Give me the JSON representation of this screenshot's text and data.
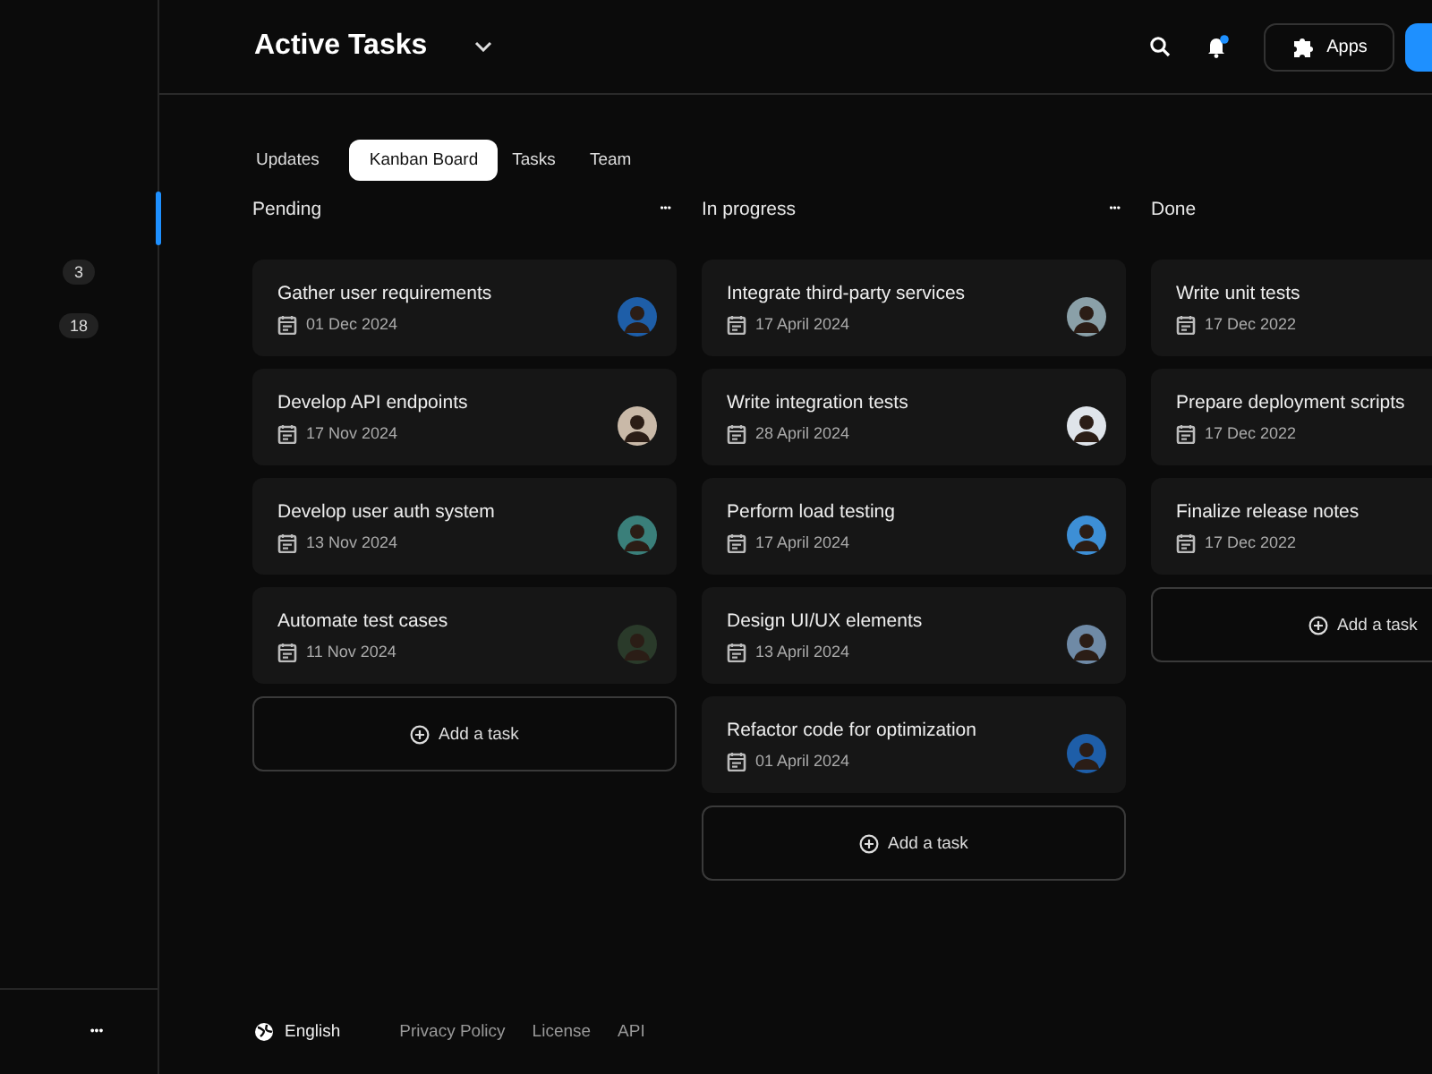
{
  "sidebar": {
    "items": [
      {
        "selected": true
      },
      {
        "badge": "3",
        "selected": false
      },
      {
        "badge": "18",
        "selected": false
      }
    ],
    "more": "•••"
  },
  "header": {
    "title": "Active Tasks",
    "notification_dot": true,
    "apps_button": "Apps"
  },
  "tabs": [
    {
      "label": "Updates",
      "selected": false
    },
    {
      "label": "Kanban Board",
      "selected": true
    },
    {
      "label": "Tasks",
      "selected": false
    },
    {
      "label": "Team",
      "selected": false
    }
  ],
  "columns": [
    {
      "title": "Pending",
      "menu": "•••",
      "add": "Add a task",
      "cards": [
        {
          "title": "Gather user requirements",
          "date": "01 Dec 2024"
        },
        {
          "title": "Develop API endpoints",
          "date": "17 Nov 2024"
        },
        {
          "title": "Develop user auth system",
          "date": "13 Nov 2024"
        },
        {
          "title": "Automate test cases",
          "date": "11 Nov 2024"
        }
      ]
    },
    {
      "title": "In progress",
      "menu": "•••",
      "add": "Add a task",
      "cards": [
        {
          "title": "Integrate third-party services",
          "date": "17 April 2024"
        },
        {
          "title": "Write integration tests",
          "date": "28 April 2024"
        },
        {
          "title": "Perform load testing",
          "date": "17 April 2024"
        },
        {
          "title": "Design UI/UX elements",
          "date": "13 April 2024"
        },
        {
          "title": "Refactor code for optimization",
          "date": "01 April 2024"
        }
      ]
    },
    {
      "title": "Done",
      "add": "Add a task",
      "cards": [
        {
          "title": "Write unit tests",
          "date": "17 Dec 2022"
        },
        {
          "title": "Prepare deployment scripts",
          "date": "17 Dec 2022"
        },
        {
          "title": "Finalize release notes",
          "date": "17 Dec 2022"
        }
      ]
    }
  ],
  "footer": {
    "language": "English",
    "links": [
      "Privacy Policy",
      "License",
      "API"
    ]
  }
}
